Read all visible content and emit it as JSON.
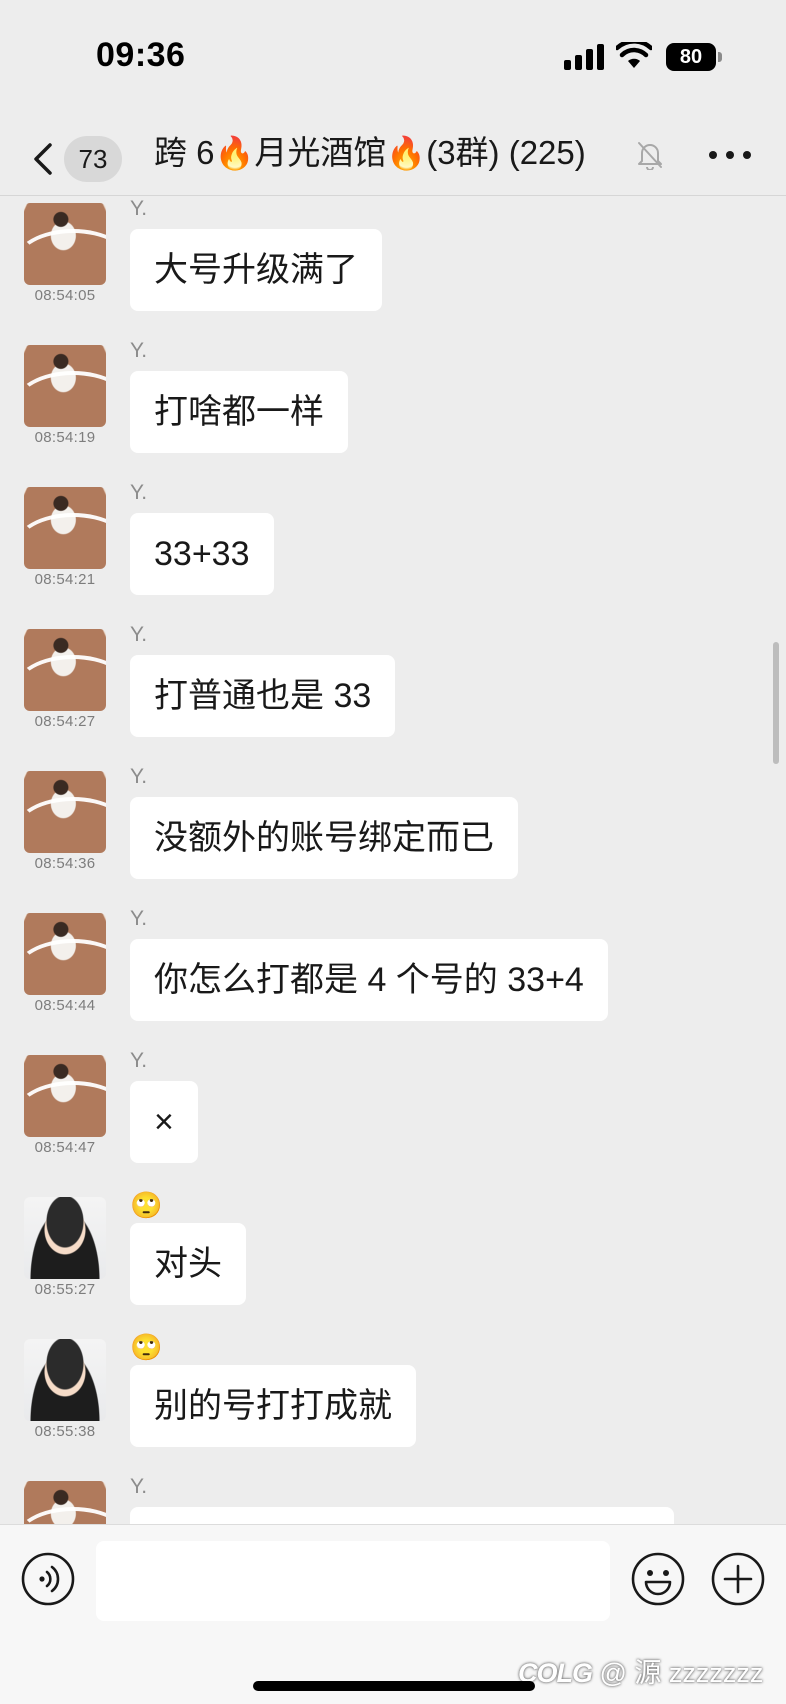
{
  "status_bar": {
    "time": "09:36",
    "battery": "80"
  },
  "nav": {
    "unread_count": "73",
    "title_prefix": "跨 6",
    "title_middle": "月光酒馆",
    "title_suffix": "(3群) (225)",
    "flame_emoji": "🔥",
    "icons": [
      "back-chevron-icon",
      "bell-muted-icon",
      "more-dots-icon"
    ]
  },
  "messages": [
    {
      "sender": "Y.",
      "time": "08:54:05",
      "text": "大号升级满了",
      "avatar": "a"
    },
    {
      "sender": "Y.",
      "time": "08:54:19",
      "text": "打啥都一样",
      "avatar": "a"
    },
    {
      "sender": "Y.",
      "time": "08:54:21",
      "text": "33+33",
      "avatar": "a"
    },
    {
      "sender": "Y.",
      "time": "08:54:27",
      "text": "打普通也是 33",
      "avatar": "a"
    },
    {
      "sender": "Y.",
      "time": "08:54:36",
      "text": "没额外的账号绑定而已",
      "avatar": "a"
    },
    {
      "sender": "Y.",
      "time": "08:54:44",
      "text": "你怎么打都是 4 个号的 33+4",
      "avatar": "a"
    },
    {
      "sender": "Y.",
      "time": "08:54:47",
      "text": "×",
      "avatar": "a"
    },
    {
      "sender_emoji": "🙄",
      "time": "08:55:27",
      "text": "对头",
      "avatar": "b"
    },
    {
      "sender_emoji": "🙄",
      "time": "08:55:38",
      "text": "别的号打打成就",
      "avatar": "b"
    },
    {
      "sender": "Y.",
      "avatar": "a"
    }
  ],
  "input_bar": {
    "icons": [
      "voice-icon",
      "emoji-icon",
      "plus-icon"
    ]
  },
  "watermark": {
    "logo": "COLG",
    "text": "@ 源 zzzzzzz"
  },
  "colors": {
    "background": "#ededed",
    "bubble": "#ffffff",
    "input_bar": "#f7f7f7"
  }
}
